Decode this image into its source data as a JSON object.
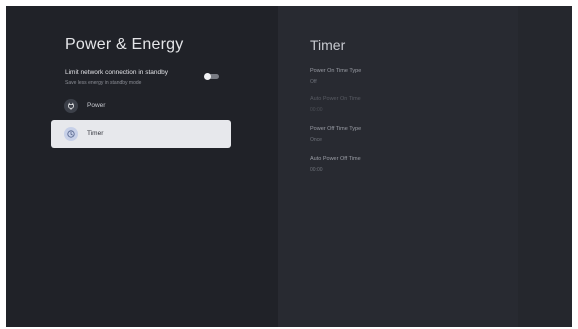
{
  "settings": {
    "title": "Power & Energy",
    "standby": {
      "title": "Limit network connection in standby",
      "subtitle": "Save less energy in standby mode",
      "toggle_on": false
    },
    "menu": [
      {
        "label": "Power",
        "icon": "power-plug-icon",
        "selected": false
      },
      {
        "label": "Timer",
        "icon": "clock-icon",
        "selected": true
      }
    ]
  },
  "timer": {
    "title": "Timer",
    "items": [
      {
        "label": "Power On Time Type",
        "value": "Off",
        "enabled": true
      },
      {
        "label": "Auto Power On Time",
        "value": "00:00",
        "enabled": false
      },
      {
        "label": "Power Off Time Type",
        "value": "Once",
        "enabled": true
      },
      {
        "label": "Auto Power Off Time",
        "value": "00:00",
        "enabled": true
      }
    ]
  },
  "colors": {
    "background": "#202228",
    "right_panel": "#282a31",
    "selected_item": "#e7e8ec",
    "icon_accent": "#c7d0e8"
  }
}
